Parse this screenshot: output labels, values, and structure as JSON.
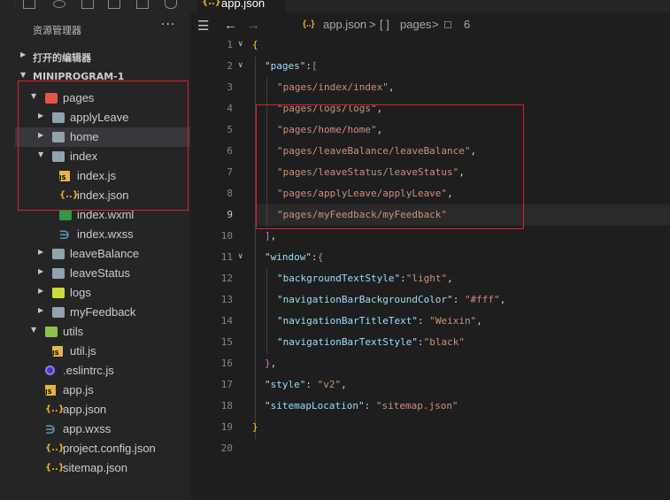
{
  "sidebar": {
    "title": "资源管理器",
    "more": "···",
    "open_editors": "打开的编辑器",
    "project": "MINIPROGRAM-1",
    "tree": [
      {
        "label": "pages",
        "type": "folder-open",
        "depth": 1,
        "twisty": "▼",
        "color": "#e8563f"
      },
      {
        "label": "applyLeave",
        "type": "folder",
        "depth": 2,
        "twisty": "▶"
      },
      {
        "label": "home",
        "type": "folder",
        "depth": 2,
        "twisty": "▶",
        "selected": true
      },
      {
        "label": "index",
        "type": "folder-open",
        "depth": 2,
        "twisty": "▼"
      },
      {
        "label": "index.js",
        "type": "js",
        "depth": 3
      },
      {
        "label": "index.json",
        "type": "json",
        "depth": 3
      },
      {
        "label": "index.wxml",
        "type": "wxml",
        "depth": 3
      },
      {
        "label": "index.wxss",
        "type": "css",
        "depth": 3
      },
      {
        "label": "leaveBalance",
        "type": "folder",
        "depth": 2,
        "twisty": "▶"
      },
      {
        "label": "leaveStatus",
        "type": "folder",
        "depth": 2,
        "twisty": "▶"
      },
      {
        "label": "logs",
        "type": "folder",
        "depth": 2,
        "twisty": "▶",
        "color": "#cddc39"
      },
      {
        "label": "myFeedback",
        "type": "folder",
        "depth": 2,
        "twisty": "▶"
      },
      {
        "label": "utils",
        "type": "folder-open",
        "depth": 1,
        "twisty": "▼",
        "color": "#8bc34a"
      },
      {
        "label": "util.js",
        "type": "js",
        "depth": 2
      },
      {
        "label": ".eslintrc.js",
        "type": "eslint",
        "depth": 1
      },
      {
        "label": "app.js",
        "type": "js",
        "depth": 1
      },
      {
        "label": "app.json",
        "type": "json",
        "depth": 1
      },
      {
        "label": "app.wxss",
        "type": "css",
        "depth": 1
      },
      {
        "label": "project.config.json",
        "type": "json",
        "depth": 1
      },
      {
        "label": "sitemap.json",
        "type": "json",
        "depth": 1
      }
    ]
  },
  "tab": {
    "icon": "{..}",
    "label": "app.json"
  },
  "breadcrumb": {
    "file_icon": "{..}",
    "file": "app.json",
    "sep1": ">",
    "arr_icon": "[ ]",
    "key": "pages",
    "sep2": ">",
    "idx_icon": "☐",
    "idx": "6"
  },
  "editor": {
    "lines": [
      {
        "n": "1",
        "fold": "∨",
        "tokens": [
          [
            "b1",
            "{"
          ]
        ],
        "indent": 0
      },
      {
        "n": "2",
        "fold": "∨",
        "tokens": [
          [
            "k",
            "\"pages\""
          ],
          [
            "p",
            ":"
          ],
          [
            "b2",
            "["
          ]
        ],
        "indent": 1
      },
      {
        "n": "3",
        "tokens": [
          [
            "s",
            "\"pages/index/index\""
          ],
          [
            "p",
            ","
          ]
        ],
        "indent": 2
      },
      {
        "n": "4",
        "tokens": [
          [
            "s",
            "\"pages/logs/logs\""
          ],
          [
            "p",
            ","
          ]
        ],
        "indent": 2
      },
      {
        "n": "5",
        "tokens": [
          [
            "s",
            "\"pages/home/home\""
          ],
          [
            "p",
            ","
          ]
        ],
        "indent": 2
      },
      {
        "n": "6",
        "tokens": [
          [
            "s",
            "\"pages/leaveBalance/leaveBalance\""
          ],
          [
            "p",
            ","
          ]
        ],
        "indent": 2
      },
      {
        "n": "7",
        "tokens": [
          [
            "s",
            "\"pages/leaveStatus/leaveStatus\""
          ],
          [
            "p",
            ","
          ]
        ],
        "indent": 2
      },
      {
        "n": "8",
        "tokens": [
          [
            "s",
            "\"pages/applyLeave/applyLeave\""
          ],
          [
            "p",
            ","
          ]
        ],
        "indent": 2
      },
      {
        "n": "9",
        "tokens": [
          [
            "s",
            "\"pages/myFeedback/myFeedback\""
          ]
        ],
        "indent": 2,
        "current": true
      },
      {
        "n": "10",
        "tokens": [
          [
            "b2",
            "]"
          ],
          [
            "p",
            ","
          ]
        ],
        "indent": 1
      },
      {
        "n": "11",
        "fold": "∨",
        "tokens": [
          [
            "k",
            "\"window\""
          ],
          [
            "p",
            ":"
          ],
          [
            "b2",
            "{"
          ]
        ],
        "indent": 1
      },
      {
        "n": "12",
        "tokens": [
          [
            "k",
            "\"backgroundTextStyle\""
          ],
          [
            "p",
            ":"
          ],
          [
            "s",
            "\"light\""
          ],
          [
            "p",
            ","
          ]
        ],
        "indent": 2
      },
      {
        "n": "13",
        "tokens": [
          [
            "k",
            "\"navigationBarBackgroundColor\""
          ],
          [
            "p",
            ": "
          ],
          [
            "s",
            "\"#fff\""
          ],
          [
            "p",
            ","
          ]
        ],
        "indent": 2
      },
      {
        "n": "14",
        "tokens": [
          [
            "k",
            "\"navigationBarTitleText\""
          ],
          [
            "p",
            ": "
          ],
          [
            "s",
            "\"Weixin\""
          ],
          [
            "p",
            ","
          ]
        ],
        "indent": 2
      },
      {
        "n": "15",
        "tokens": [
          [
            "k",
            "\"navigationBarTextStyle\""
          ],
          [
            "p",
            ":"
          ],
          [
            "s",
            "\"black\""
          ]
        ],
        "indent": 2
      },
      {
        "n": "16",
        "tokens": [
          [
            "b2",
            "}"
          ],
          [
            "p",
            ","
          ]
        ],
        "indent": 1
      },
      {
        "n": "17",
        "tokens": [
          [
            "k",
            "\"style\""
          ],
          [
            "p",
            ": "
          ],
          [
            "s",
            "\"v2\""
          ],
          [
            "p",
            ","
          ]
        ],
        "indent": 1
      },
      {
        "n": "18",
        "tokens": [
          [
            "k",
            "\"sitemapLocation\""
          ],
          [
            "p",
            ": "
          ],
          [
            "s",
            "\"sitemap.json\""
          ]
        ],
        "indent": 1
      },
      {
        "n": "19",
        "tokens": [
          [
            "b1",
            "}"
          ]
        ],
        "indent": 0
      },
      {
        "n": "20",
        "tokens": [],
        "indent": 0
      }
    ]
  },
  "colors": {
    "annotation": "#e0202a",
    "folder": "#90a4ae"
  }
}
